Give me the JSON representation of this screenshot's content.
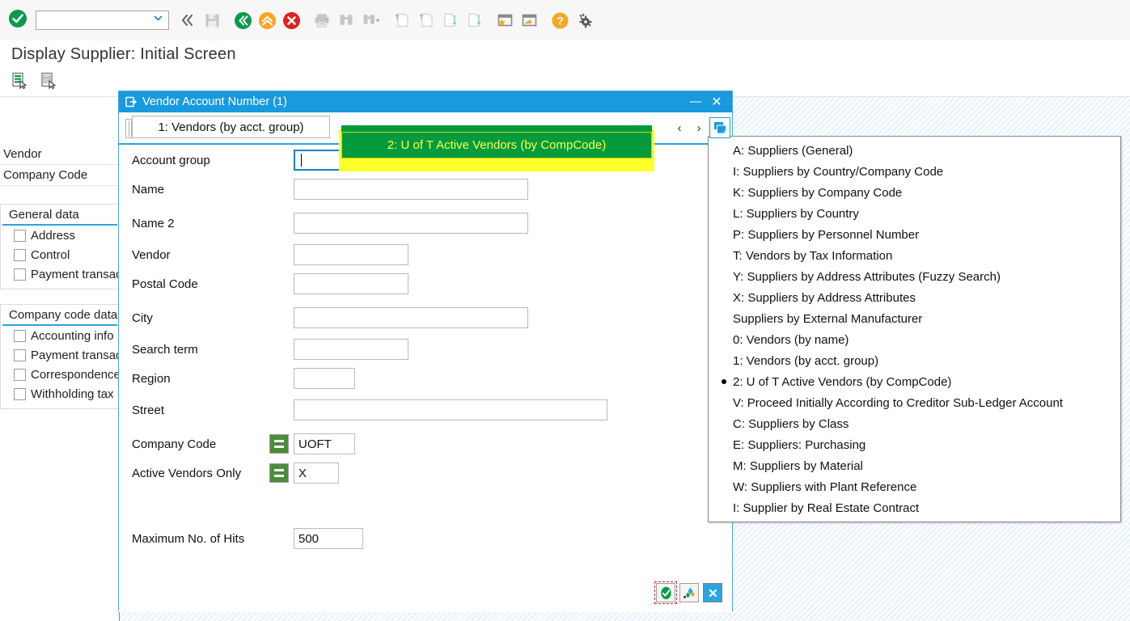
{
  "toolbar": {
    "ok_icon": "green-check-circle-icon",
    "command_field": {
      "value": "",
      "placeholder": ""
    },
    "buttons": [
      {
        "name": "back-arrows-icon",
        "label": "Back"
      },
      {
        "name": "save-icon",
        "label": "Save"
      },
      {
        "name": "back-green-icon",
        "label": "Back"
      },
      {
        "name": "exit-yellow-icon",
        "label": "Exit"
      },
      {
        "name": "cancel-red-icon",
        "label": "Cancel"
      },
      {
        "name": "print-icon",
        "label": "Print"
      },
      {
        "name": "find-icon",
        "label": "Find"
      },
      {
        "name": "find-next-icon",
        "label": "Find Next"
      },
      {
        "name": "first-page-icon",
        "label": "First Page"
      },
      {
        "name": "previous-page-icon",
        "label": "Previous Page"
      },
      {
        "name": "next-page-icon",
        "label": "Next Page"
      },
      {
        "name": "last-page-icon",
        "label": "Last Page"
      },
      {
        "name": "create-session-icon",
        "label": "Create New Session"
      },
      {
        "name": "create-shortcut-icon",
        "label": "Create Shortcut"
      },
      {
        "name": "help-icon",
        "label": "Help"
      },
      {
        "name": "customize-local-layout-icon",
        "label": "Customize Local Layout"
      }
    ]
  },
  "screen": {
    "title": "Display Supplier:  Initial Screen",
    "app_buttons": [
      {
        "name": "list-selection-green-icon",
        "label": "Supplier list"
      },
      {
        "name": "list-selection-grey-icon",
        "label": "Supplier list 2"
      }
    ]
  },
  "background_form": {
    "rows": [
      {
        "label": "Vendor",
        "value": ""
      },
      {
        "label": "Company Code",
        "value": ""
      }
    ],
    "groups": [
      {
        "title": "General data",
        "items": [
          {
            "label": "Address",
            "checked": false
          },
          {
            "label": "Control",
            "checked": false
          },
          {
            "label": "Payment transactions",
            "checked": false
          }
        ]
      },
      {
        "title": "Company code data",
        "items": [
          {
            "label": "Accounting info",
            "checked": false
          },
          {
            "label": "Payment transactions",
            "checked": false
          },
          {
            "label": "Correspondence",
            "checked": false
          },
          {
            "label": "Withholding tax",
            "checked": false
          }
        ]
      }
    ]
  },
  "dialog": {
    "title": "Vendor Account Number (1)",
    "window_buttons": [
      {
        "name": "minimize-button",
        "glyph": "—"
      },
      {
        "name": "close-button",
        "glyph": "✕"
      }
    ],
    "tabs": [
      {
        "label": "1: Vendors (by acct. group)",
        "active": false
      },
      {
        "label": "2: U of T Active Vendors (by CompCode)",
        "active": true
      }
    ],
    "tab_nav": {
      "prev": "‹",
      "next": "›",
      "more": "more-tabs-button"
    },
    "fields": [
      {
        "label": "Account group",
        "value": "",
        "has_dropdown": true,
        "focused": true
      },
      {
        "label": "Name",
        "value": ""
      },
      {
        "label": "Name 2",
        "value": ""
      },
      {
        "label": "Vendor",
        "value": ""
      },
      {
        "label": "Postal Code",
        "value": ""
      },
      {
        "label": "City",
        "value": ""
      },
      {
        "label": "Search term",
        "value": ""
      },
      {
        "label": "Region",
        "value": ""
      },
      {
        "label": "Street",
        "value": ""
      },
      {
        "label": "Company Code",
        "value": "UOFT",
        "operator": "="
      },
      {
        "label": "Active Vendors Only",
        "value": "X",
        "operator": "="
      },
      {
        "label": "Maximum No. of Hits",
        "value": "500"
      }
    ],
    "footer_buttons": [
      {
        "name": "confirm-button",
        "glyph": "✓",
        "focused": true
      },
      {
        "name": "multiple-selection-button",
        "glyph": "❖",
        "focused": false
      },
      {
        "name": "cancel-button",
        "glyph": "✕",
        "focused": false
      }
    ]
  },
  "menu": {
    "items": [
      {
        "label": "A: Suppliers (General)",
        "selected": false
      },
      {
        "label": "I: Suppliers by Country/Company Code",
        "selected": false
      },
      {
        "label": "K: Suppliers by Company Code",
        "selected": false
      },
      {
        "label": "L: Suppliers by Country",
        "selected": false
      },
      {
        "label": "P: Suppliers by Personnel Number",
        "selected": false
      },
      {
        "label": "T: Vendors by Tax Information",
        "selected": false
      },
      {
        "label": "Y: Suppliers by Address Attributes (Fuzzy Search)",
        "selected": false
      },
      {
        "label": "X: Suppliers by Address Attributes",
        "selected": false
      },
      {
        "label": "Suppliers by External Manufacturer",
        "selected": false
      },
      {
        "label": "0: Vendors (by name)",
        "selected": false
      },
      {
        "label": "1: Vendors (by acct. group)",
        "selected": false
      },
      {
        "label": "2: U of T Active Vendors (by CompCode)",
        "selected": true
      },
      {
        "label": "V: Proceed Initially According to Creditor Sub-Ledger Account",
        "selected": false
      },
      {
        "label": "C: Suppliers by Class",
        "selected": false
      },
      {
        "label": "E: Suppliers: Purchasing",
        "selected": false
      },
      {
        "label": "M: Suppliers by Material",
        "selected": false
      },
      {
        "label": "W: Suppliers with Plant Reference",
        "selected": false
      },
      {
        "label": "I: Supplier by Real Estate Contract",
        "selected": false
      }
    ]
  },
  "colors": {
    "accent_blue": "#1a9ade",
    "tab_active_green": "#039b3e",
    "tab_active_text": "#ffff4a",
    "highlight_yellow": "#ffff2e",
    "operator_green": "#4b8c3b",
    "ok_green": "#0a9a4a",
    "exit_yellow": "#f5a623",
    "cancel_red": "#d9241f"
  }
}
